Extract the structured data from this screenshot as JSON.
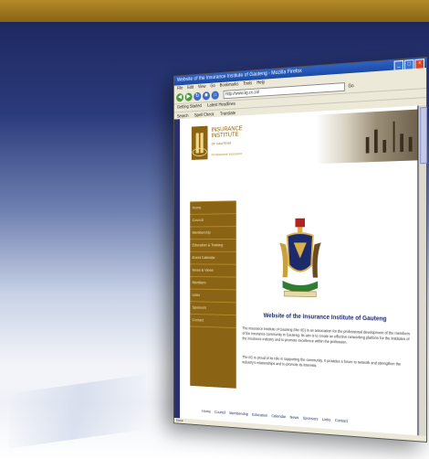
{
  "colors": {
    "band": "#8a6414",
    "background_top": "#1f2a63",
    "sidebar": "#8a6414",
    "page_frame": "#2b2f6b"
  },
  "browser": {
    "title": "Website of the Insurance Institute of Gauteng - Mozilla Firefox",
    "menu": [
      "File",
      "Edit",
      "View",
      "Go",
      "Bookmarks",
      "Tools",
      "Help"
    ],
    "address": "http://www.iig.co.za/",
    "go_label": "Go",
    "bookmarks": [
      "Getting Started",
      "Latest Headlines"
    ],
    "toolbar2": [
      "Search",
      "Spell Check",
      "Translate"
    ],
    "status": "Done"
  },
  "site": {
    "brand_line1": "INSURANCE",
    "brand_line2": "INSTITUTE",
    "brand_line3": "OF GAUTENG",
    "tagline": "Professional Insurance",
    "nav": [
      "Home",
      "Council",
      "Membership",
      "Education & Training",
      "Event Calendar",
      "News & Views",
      "Members",
      "Links",
      "Sponsors",
      "Contact"
    ],
    "title": "Website of the Insurance Institute of Gauteng",
    "para1": "The Insurance Institute of Gauteng (the IIG) is an association for the professional development of the members of the insurance community in Gauteng. Its aim is to create an effective networking platform for the institutes of the insurance industry and to promote excellence within the profession.",
    "para2": "The IIG is proud of its role in supporting the community. It provides a forum to network and strengthen the industry's relationships and to promote its interests.",
    "footer": [
      "Home",
      "Council",
      "Membership",
      "Education",
      "Calendar",
      "News",
      "Sponsors",
      "Links",
      "Contact"
    ]
  }
}
